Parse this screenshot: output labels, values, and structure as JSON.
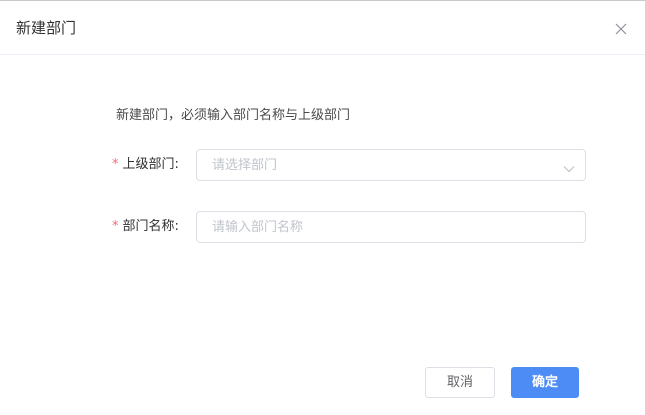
{
  "dialog": {
    "title": "新建部门",
    "close_icon": "close-icon"
  },
  "hint": "新建部门，必须输入部门名称与上级部门",
  "form": {
    "parent_dept": {
      "required_mark": "*",
      "label": "上级部门:",
      "placeholder": "请选择部门",
      "value": "",
      "icon": "chevron-down-icon"
    },
    "dept_name": {
      "required_mark": "*",
      "label": "部门名称:",
      "placeholder": "请输入部门名称",
      "value": ""
    }
  },
  "footer": {
    "cancel_label": "取消",
    "confirm_label": "确定"
  },
  "colors": {
    "primary": "#4d8cf5",
    "required": "#f56c6c",
    "placeholder": "#c0c4cc",
    "border": "#dcdfe6"
  }
}
